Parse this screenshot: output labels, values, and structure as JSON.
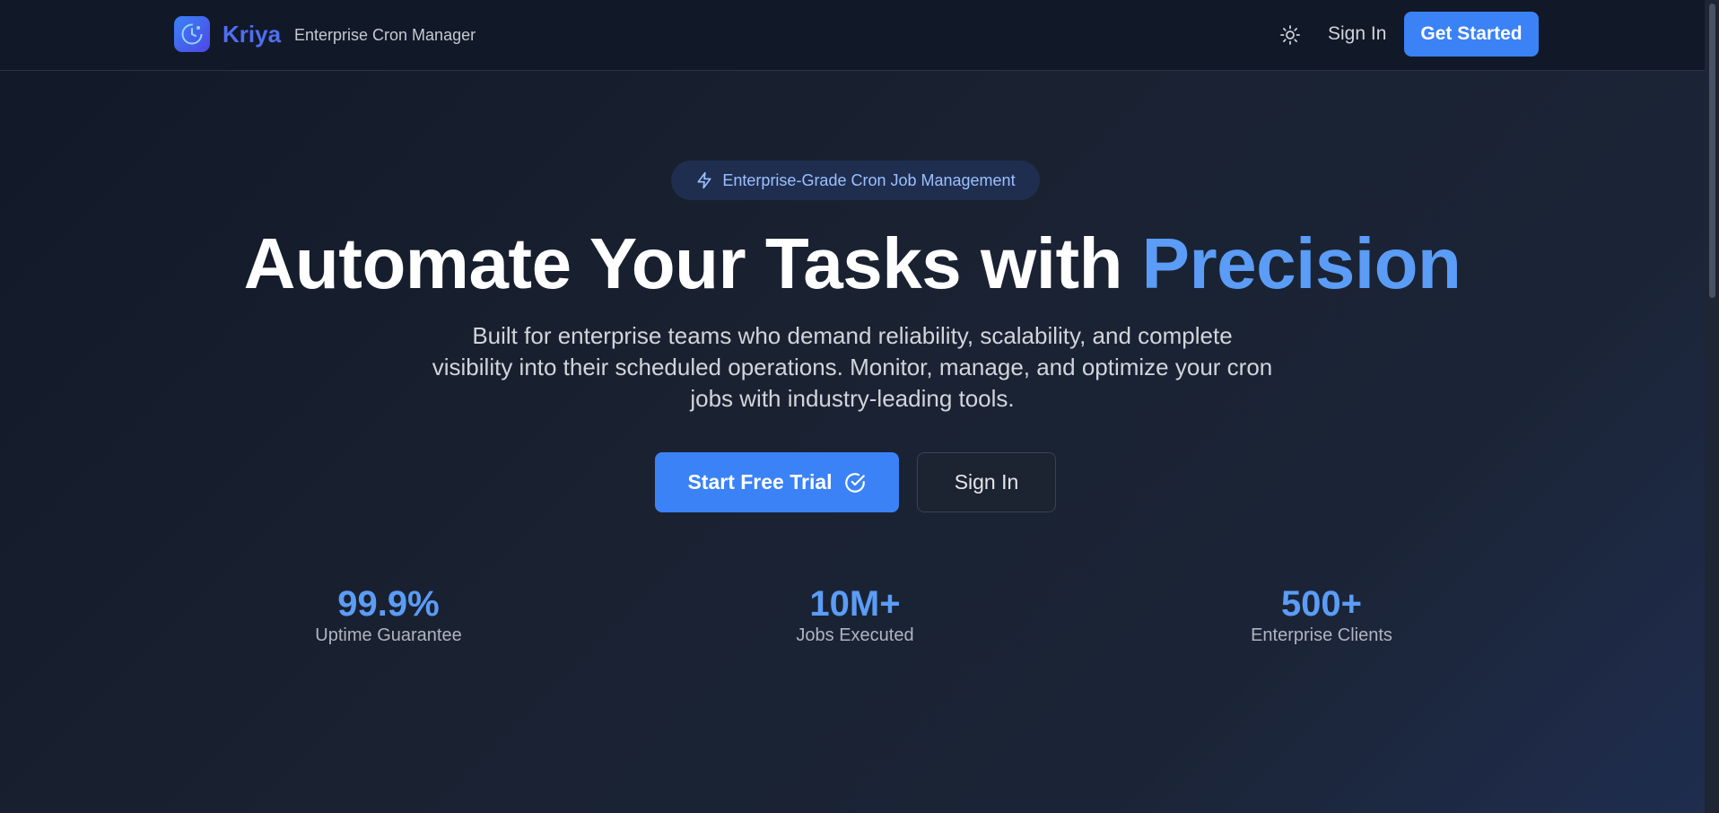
{
  "header": {
    "brand": "Kriya",
    "tagline": "Enterprise Cron Manager",
    "theme_toggle_icon": "sun-icon",
    "sign_in": "Sign In",
    "get_started": "Get Started"
  },
  "hero": {
    "badge_icon": "lightning-icon",
    "badge": "Enterprise-Grade Cron Job Management",
    "title_main": "Automate Your Tasks with ",
    "title_accent": "Precision",
    "description": "Built for enterprise teams who demand reliability, scalability, and complete visibility into their scheduled operations. Monitor, manage, and optimize your cron jobs with industry-leading tools.",
    "primary_cta": "Start Free Trial",
    "primary_cta_icon": "check-circle-icon",
    "secondary_cta": "Sign In"
  },
  "stats": [
    {
      "value": "99.9%",
      "label": "Uptime Guarantee"
    },
    {
      "value": "10M+",
      "label": "Jobs Executed"
    },
    {
      "value": "500+",
      "label": "Enterprise Clients"
    }
  ],
  "colors": {
    "accent": "#3b82f6",
    "accent_text": "#5b9cf6",
    "brand": "#4f6ff0",
    "background": "#111827"
  }
}
